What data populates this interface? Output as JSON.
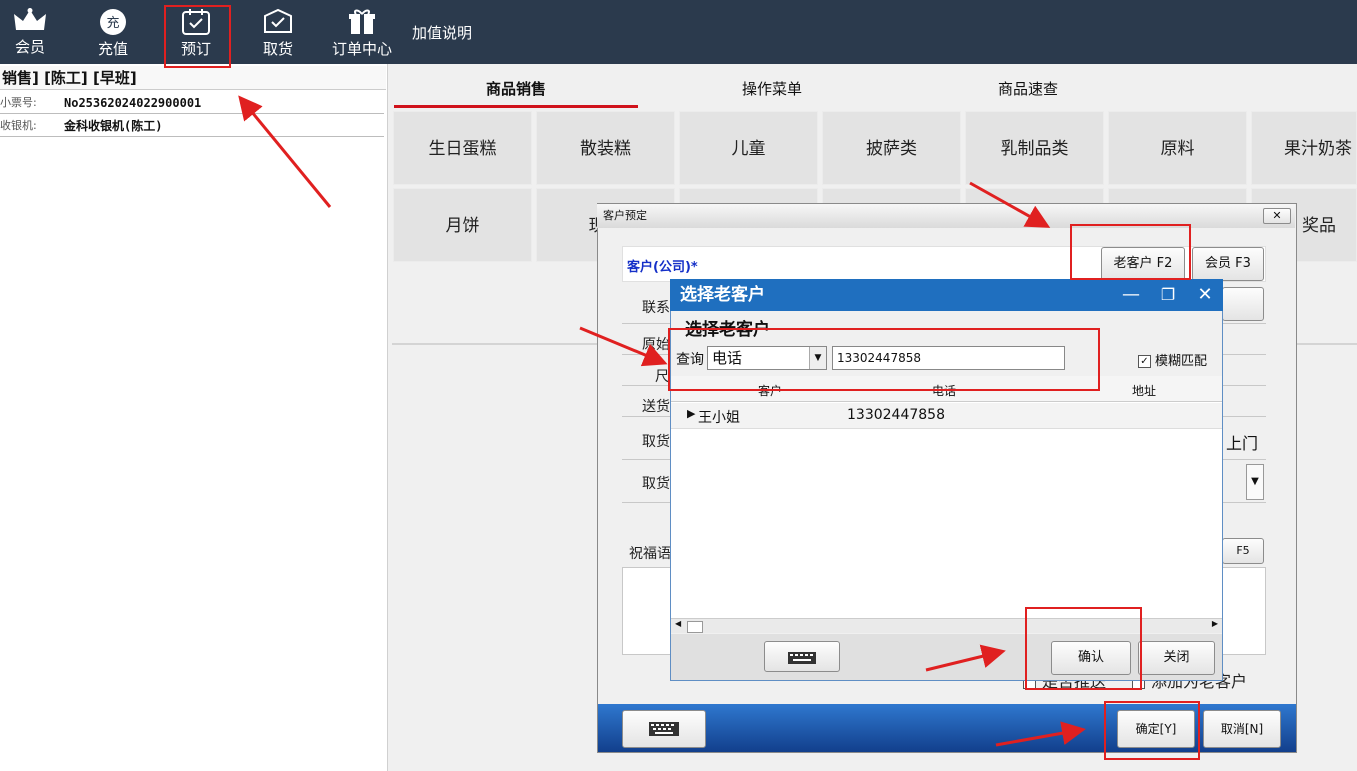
{
  "toolbar": {
    "items": [
      {
        "label": "会员",
        "icon": "crown-icon"
      },
      {
        "label": "充值",
        "icon": "recharge-icon",
        "icon_char": "充"
      },
      {
        "label": "预订",
        "icon": "calendar-check-icon"
      },
      {
        "label": "取货",
        "icon": "box-check-icon"
      },
      {
        "label": "订单中心",
        "icon": "gift-icon"
      }
    ],
    "extra_link": "加值说明"
  },
  "left": {
    "title": "销售] [陈工] [早班]",
    "rows": [
      {
        "key": "小票号:",
        "value": "No25362024022900001"
      },
      {
        "key": "收银机:",
        "value": "金科收银机(陈工)"
      }
    ]
  },
  "tabs": [
    {
      "label": "商品销售",
      "active": true
    },
    {
      "label": "操作菜单",
      "active": false
    },
    {
      "label": "商品速查",
      "active": false
    }
  ],
  "categories": {
    "row1": [
      "生日蛋糕",
      "散装糕",
      "儿童",
      "披萨类",
      "乳制品类",
      "原料",
      "果汁奶茶"
    ],
    "row2": [
      "月饼",
      "现烤",
      "奖品"
    ]
  },
  "reservation_dialog": {
    "title": "客户预定",
    "customer_label": "客户(公司)*",
    "old_customer_button": "老客户 F2",
    "member_button": "会员 F3",
    "field_labels": [
      "联系",
      "原始",
      "尺",
      "送货",
      "取货",
      "取货"
    ],
    "pickup_suffix": "上门",
    "blessing_label": "祝福语",
    "f5_button": "F5",
    "checkbox_text": "是否推送",
    "add_old_customer_text": "添加为老客户",
    "confirm_button": "确定[Y]",
    "cancel_button": "取消[N]"
  },
  "select_dialog": {
    "title": "选择老客户",
    "heading": "选择老客户",
    "query_label": "查询",
    "query_type": "电话",
    "query_value": "13302447858",
    "fuzzy_label": "模糊匹配",
    "fuzzy_checked": true,
    "columns": [
      "客户",
      "电话",
      "地址"
    ],
    "rows": [
      {
        "customer": "王小姐",
        "phone": "13302447858",
        "address": ""
      }
    ],
    "confirm_button": "确认",
    "close_button": "关闭"
  },
  "colors": {
    "topbar": "#2b3a4d",
    "dialog_title_blue": "#1f6fbf",
    "dialog_footer_blue": "#1b5fb3",
    "annotation_red": "#e02020"
  }
}
